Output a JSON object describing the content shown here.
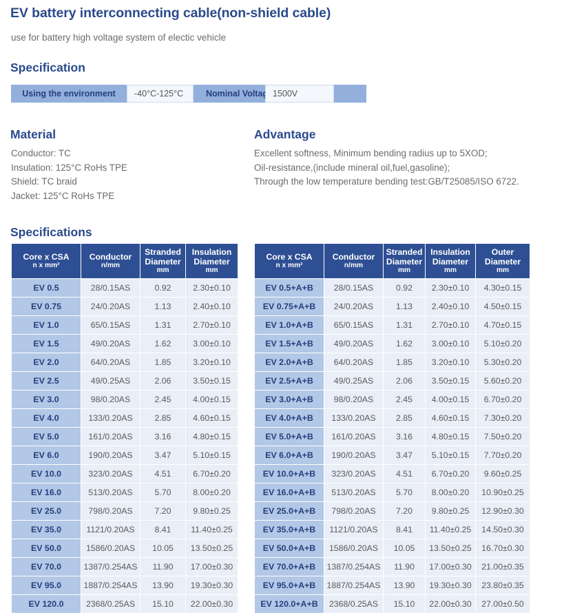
{
  "title": "EV battery interconnecting cable(non-shield cable)",
  "subtitle": "use for battery high voltage system of electic vehicle",
  "headings": {
    "specification": "Specification",
    "material": "Material",
    "advantage": "Advantage",
    "specifications": "Specifications"
  },
  "colors": {
    "heading_blue": "#2a4a8c",
    "table_header_blue": "#2e4f93",
    "name_cell_blue": "#b3c7e6",
    "data_cell_blue": "#e9eef7",
    "spec_bar_blue": "#93b0dc",
    "body_gray": "#6b6b6b"
  },
  "spec_bar": {
    "label_1": "Using the environment",
    "value_1": "-40°C-125°C",
    "label_2": "Nominal Voltage",
    "value_2": "1500V"
  },
  "material": {
    "lines": [
      "Conductor: TC",
      "Insulation: 125°C RoHs TPE",
      "Shield: TC braid",
      "Jacket: 125°C RoHs TPE"
    ]
  },
  "advantage": {
    "lines": [
      "Excellent softness, Minimum bending radius up to 5XOD;",
      "Oil-resistance,(include mineral oil,fuel,gasoline);",
      "Through the low temperature bending test:GB/T25085/ISO 6722."
    ]
  },
  "table_left": {
    "columns": [
      {
        "title": "Core x CSA",
        "unit": "n x mm²"
      },
      {
        "title": "Conductor",
        "unit": "n/mm"
      },
      {
        "title": "Stranded Diameter",
        "unit": "mm"
      },
      {
        "title": "Insulation Diameter",
        "unit": "mm"
      }
    ],
    "rows": [
      [
        "EV 0.5",
        "28/0.15AS",
        "0.92",
        "2.30±0.10"
      ],
      [
        "EV 0.75",
        "24/0.20AS",
        "1.13",
        "2.40±0.10"
      ],
      [
        "EV 1.0",
        "65/0.15AS",
        "1.31",
        "2.70±0.10"
      ],
      [
        "EV 1.5",
        "49/0.20AS",
        "1.62",
        "3.00±0.10"
      ],
      [
        "EV 2.0",
        "64/0.20AS",
        "1.85",
        "3.20±0.10"
      ],
      [
        "EV 2.5",
        "49/0.25AS",
        "2.06",
        "3.50±0.15"
      ],
      [
        "EV 3.0",
        "98/0.20AS",
        "2.45",
        "4.00±0.15"
      ],
      [
        "EV 4.0",
        "133/0.20AS",
        "2.85",
        "4.60±0.15"
      ],
      [
        "EV 5.0",
        "161/0.20AS",
        "3.16",
        "4.80±0.15"
      ],
      [
        "EV 6.0",
        "190/0.20AS",
        "3.47",
        "5.10±0.15"
      ],
      [
        "EV 10.0",
        "323/0.20AS",
        "4.51",
        "6.70±0.20"
      ],
      [
        "EV 16.0",
        "513/0.20AS",
        "5.70",
        "8.00±0.20"
      ],
      [
        "EV 25.0",
        "798/0.20AS",
        "7.20",
        "9.80±0.25"
      ],
      [
        "EV 35.0",
        "1121/0.20AS",
        "8.41",
        "11.40±0.25"
      ],
      [
        "EV 50.0",
        "1586/0.20AS",
        "10.05",
        "13.50±0.25"
      ],
      [
        "EV 70.0",
        "1387/0.254AS",
        "11.90",
        "17.00±0.30"
      ],
      [
        "EV 95.0",
        "1887/0.254AS",
        "13.90",
        "19.30±0.30"
      ],
      [
        "EV 120.0",
        "2368/0.25AS",
        "15.10",
        "22.00±0.30"
      ]
    ]
  },
  "table_right": {
    "columns": [
      {
        "title": "Core x CSA",
        "unit": "n x mm²"
      },
      {
        "title": "Conductor",
        "unit": "n/mm"
      },
      {
        "title": "Stranded Diameter",
        "unit": "mm"
      },
      {
        "title": "Insulation Diameter",
        "unit": "mm"
      },
      {
        "title": "Outer Diameter",
        "unit": "mm"
      }
    ],
    "rows": [
      [
        "EV 0.5+A+B",
        "28/0.15AS",
        "0.92",
        "2.30±0.10",
        "4.30±0.15"
      ],
      [
        "EV 0.75+A+B",
        "24/0.20AS",
        "1.13",
        "2.40±0.10",
        "4.50±0.15"
      ],
      [
        "EV 1.0+A+B",
        "65/0.15AS",
        "1.31",
        "2.70±0.10",
        "4.70±0.15"
      ],
      [
        "EV 1.5+A+B",
        "49/0.20AS",
        "1.62",
        "3.00±0.10",
        "5.10±0.20"
      ],
      [
        "EV 2.0+A+B",
        "64/0.20AS",
        "1.85",
        "3.20±0.10",
        "5.30±0.20"
      ],
      [
        "EV 2.5+A+B",
        "49/0.25AS",
        "2.06",
        "3.50±0.15",
        "5.60±0.20"
      ],
      [
        "EV 3.0+A+B",
        "98/0.20AS",
        "2.45",
        "4.00±0.15",
        "6.70±0.20"
      ],
      [
        "EV 4.0+A+B",
        "133/0.20AS",
        "2.85",
        "4.60±0.15",
        "7.30±0.20"
      ],
      [
        "EV 5.0+A+B",
        "161/0.20AS",
        "3.16",
        "4.80±0.15",
        "7.50±0.20"
      ],
      [
        "EV 6.0+A+B",
        "190/0.20AS",
        "3.47",
        "5.10±0.15",
        "7.70±0.20"
      ],
      [
        "EV 10.0+A+B",
        "323/0.20AS",
        "4.51",
        "6.70±0.20",
        "9.60±0.25"
      ],
      [
        "EV 16.0+A+B",
        "513/0.20AS",
        "5.70",
        "8.00±0.20",
        "10.90±0.25"
      ],
      [
        "EV 25.0+A+B",
        "798/0.20AS",
        "7.20",
        "9.80±0.25",
        "12.90±0.30"
      ],
      [
        "EV 35.0+A+B",
        "1121/0.20AS",
        "8.41",
        "11.40±0.25",
        "14.50±0.30"
      ],
      [
        "EV 50.0+A+B",
        "1586/0.20AS",
        "10.05",
        "13.50±0.25",
        "16.70±0.30"
      ],
      [
        "EV 70.0+A+B",
        "1387/0.254AS",
        "11.90",
        "17.00±0.30",
        "21.00±0.35"
      ],
      [
        "EV 95.0+A+B",
        "1887/0.254AS",
        "13.90",
        "19.30±0.30",
        "23.80±0.35"
      ],
      [
        "EV 120.0+A+B",
        "2368/0.25AS",
        "15.10",
        "22.00±0.30",
        "27.00±0.50"
      ]
    ]
  }
}
